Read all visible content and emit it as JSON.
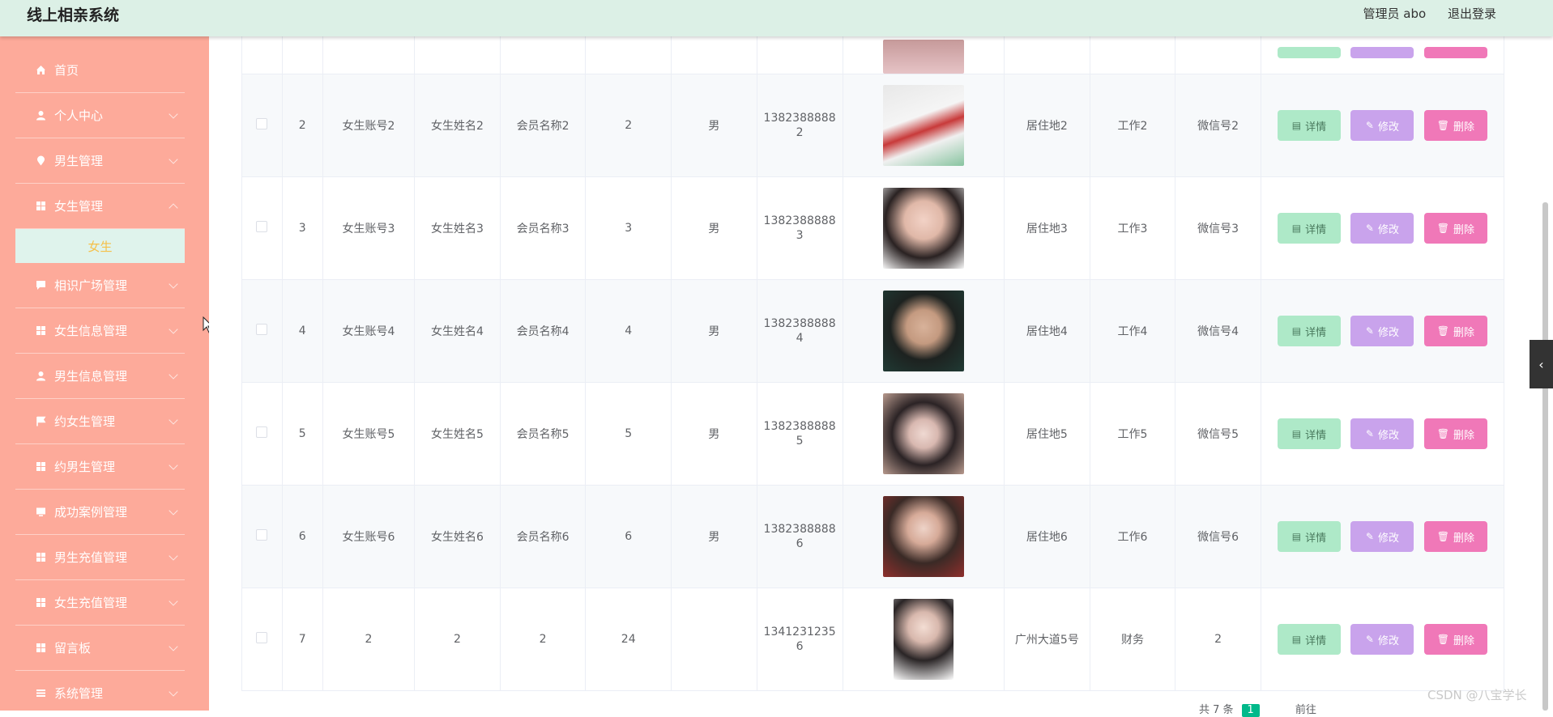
{
  "header": {
    "title": "线上相亲系统",
    "user": "管理员 abo",
    "logout": "退出登录"
  },
  "sidebar": {
    "items": [
      {
        "label": "首页",
        "icon": "home-icon",
        "expandable": false
      },
      {
        "label": "个人中心",
        "icon": "user-icon",
        "expandable": true
      },
      {
        "label": "男生管理",
        "icon": "pin-icon",
        "expandable": true
      },
      {
        "label": "女生管理",
        "icon": "grid-icon",
        "expandable": true
      },
      {
        "label": "相识广场管理",
        "icon": "chat-icon",
        "expandable": true
      },
      {
        "label": "女生信息管理",
        "icon": "grid-icon",
        "expandable": true
      },
      {
        "label": "男生信息管理",
        "icon": "user-icon",
        "expandable": true
      },
      {
        "label": "约女生管理",
        "icon": "flag-icon",
        "expandable": true
      },
      {
        "label": "约男生管理",
        "icon": "grid-icon",
        "expandable": true
      },
      {
        "label": "成功案例管理",
        "icon": "screen-icon",
        "expandable": true
      },
      {
        "label": "男生充值管理",
        "icon": "grid-icon",
        "expandable": true
      },
      {
        "label": "女生充值管理",
        "icon": "grid-icon",
        "expandable": true
      },
      {
        "label": "留言板",
        "icon": "grid-icon",
        "expandable": true
      },
      {
        "label": "系统管理",
        "icon": "menu-icon",
        "expandable": true
      }
    ],
    "submenu_active": "女生"
  },
  "table": {
    "buttons": {
      "detail": "详情",
      "edit": "修改",
      "delete": "删除"
    },
    "rows": [
      {
        "index": "2",
        "account": "女生账号2",
        "name": "女生姓名2",
        "member": "会员名称2",
        "age": "2",
        "gender": "男",
        "phone_a": "1382388888",
        "phone_b": "2",
        "address": "居住地2",
        "job": "工作2",
        "wechat": "微信号2"
      },
      {
        "index": "3",
        "account": "女生账号3",
        "name": "女生姓名3",
        "member": "会员名称3",
        "age": "3",
        "gender": "男",
        "phone_a": "1382388888",
        "phone_b": "3",
        "address": "居住地3",
        "job": "工作3",
        "wechat": "微信号3"
      },
      {
        "index": "4",
        "account": "女生账号4",
        "name": "女生姓名4",
        "member": "会员名称4",
        "age": "4",
        "gender": "男",
        "phone_a": "1382388888",
        "phone_b": "4",
        "address": "居住地4",
        "job": "工作4",
        "wechat": "微信号4"
      },
      {
        "index": "5",
        "account": "女生账号5",
        "name": "女生姓名5",
        "member": "会员名称5",
        "age": "5",
        "gender": "男",
        "phone_a": "1382388888",
        "phone_b": "5",
        "address": "居住地5",
        "job": "工作5",
        "wechat": "微信号5"
      },
      {
        "index": "6",
        "account": "女生账号6",
        "name": "女生姓名6",
        "member": "会员名称6",
        "age": "6",
        "gender": "男",
        "phone_a": "1382388888",
        "phone_b": "6",
        "address": "居住地6",
        "job": "工作6",
        "wechat": "微信号6"
      },
      {
        "index": "7",
        "account": "2",
        "name": "2",
        "member": "2",
        "age": "24",
        "gender": "",
        "phone_a": "1341231235",
        "phone_b": "6",
        "address": "广州大道5号",
        "job": "财务",
        "wechat": "2"
      }
    ]
  },
  "pager": {
    "total": "共 7 条",
    "current": "1",
    "goto": "前往"
  },
  "watermark": "CSDN @八宝学长",
  "colors": {
    "header": "#dcf0e6",
    "sidebar": "#fdaa9a",
    "detail": "#aee9c8",
    "edit": "#c9a3ec",
    "delete": "#f078b8",
    "active_page": "#00b98a"
  }
}
